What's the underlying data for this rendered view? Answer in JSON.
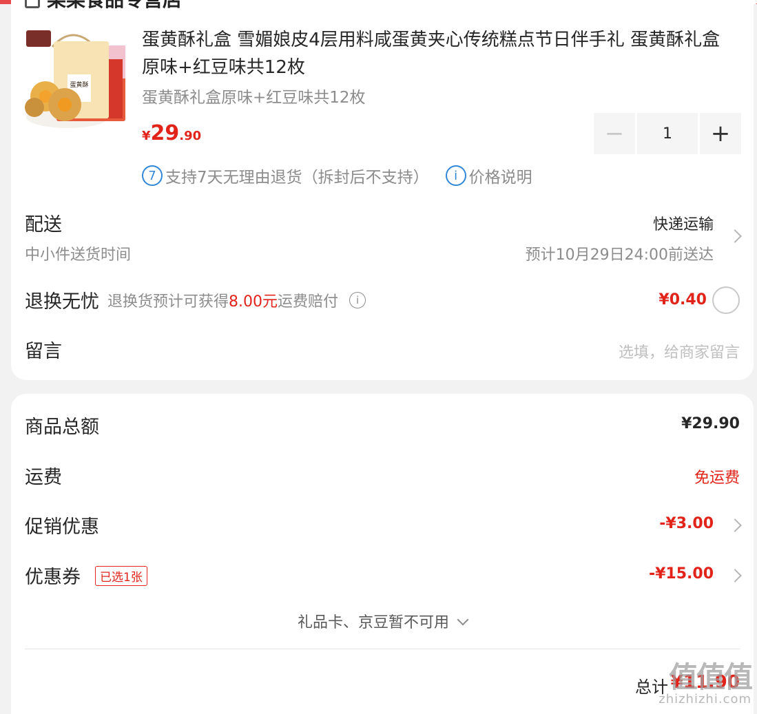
{
  "store": {
    "name": "某某食品专营店"
  },
  "product": {
    "title": "蛋黄酥礼盒 雪媚娘皮4层用料咸蛋黄夹心传统糕点节日伴手礼 蛋黄酥礼盒原味+红豆味共12枚",
    "spec": "蛋黄酥礼盒原味+红豆味共12枚",
    "price_symbol": "¥",
    "price_int": "29",
    "price_dec": ".90",
    "quantity": "1",
    "box_label": "蛋黄酥",
    "services": {
      "return_icon": "7",
      "return_text": "支持7天无理由退货（拆封后不支持）",
      "info_icon": "i",
      "price_note": "价格说明"
    }
  },
  "delivery": {
    "label": "配送",
    "sub": "中小件送货时间",
    "method": "快递运输",
    "eta": "预计10月29日24:00前送达"
  },
  "returns": {
    "label": "退换无忧",
    "note_prefix": "退换货预计可获得",
    "note_amount": "8.00元",
    "note_suffix": "运费赔付",
    "info_icon": "i",
    "price": "¥0.40"
  },
  "message": {
    "label": "留言",
    "placeholder": "选填，给商家留言"
  },
  "summary": {
    "goods_label": "商品总额",
    "goods_value": "¥29.90",
    "shipping_label": "运费",
    "shipping_value": "免运费",
    "promo_label": "促销优惠",
    "promo_value": "-¥3.00",
    "coupon_label": "优惠券",
    "coupon_tag": "已选1张",
    "coupon_value": "-¥15.00",
    "unavailable": "礼品卡、京豆暂不可用",
    "total_label": "总计",
    "total_value": "¥11.90"
  },
  "watermark": {
    "big": "值值值",
    "small": "zhizhizhi.com"
  },
  "colors": {
    "accent": "#e2231a",
    "info": "#2f87d7",
    "muted": "#8c8c8c"
  }
}
